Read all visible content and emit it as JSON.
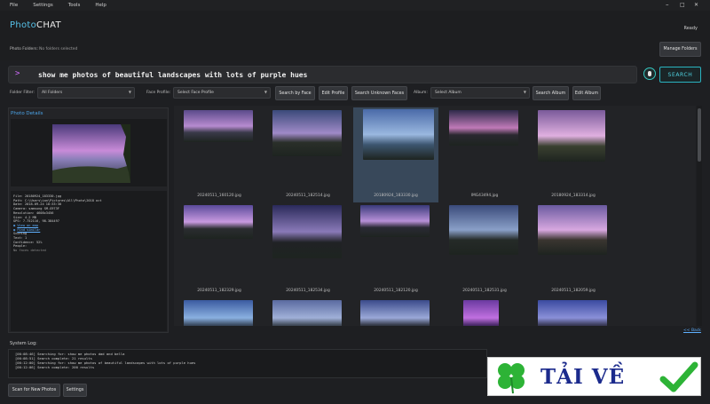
{
  "menu": [
    "File",
    "Settings",
    "Tools",
    "Help"
  ],
  "window_controls": {
    "minimize": "–",
    "maximize": "□",
    "close": "✕"
  },
  "app": {
    "logo_part1": "Photo",
    "logo_part2": "CHAT",
    "status": "Ready"
  },
  "folders": {
    "label": "Photo Folders:",
    "value": "No folders selected",
    "manage_button": "Manage Folders"
  },
  "search": {
    "prompt": ">",
    "query": "show me photos of beautiful landscapes with lots of purple hues",
    "button": "SEARCH"
  },
  "filters": {
    "folder_label": "Folder Filter:",
    "folder_value": "All Folders",
    "face_label": "Face Profile:",
    "face_value": "Select Face Profile",
    "search_by_face": "Search by Face",
    "edit_profile": "Edit Profile",
    "search_unknown": "Search Unknown Faces",
    "album_label": "Album:",
    "album_value": "Select Album",
    "search_album": "Search Album",
    "edit_album": "Edit Album"
  },
  "details_panel": {
    "title": "Photo Details",
    "lines": [
      "File: 20180924_183330.jpg",
      "Path: C:\\Users\\ian\\Pictures\\All\\Photo\\2018 oct",
      "Date: 2018-09-24 18:33:30",
      "Camera: samsung SM-G973F",
      "Resolution: 4608x3456",
      "Size: 4.2 MB",
      "GPS: 7.752116, 98.384497"
    ],
    "link_map": "View on map",
    "link_similar": "Find similar",
    "lines2": [
      "Scoring",
      "Text: 1",
      "Confidence: 52%",
      "People:",
      "No faces detected"
    ]
  },
  "photos": [
    {
      "name": "20240511_160120.jpg"
    },
    {
      "name": "20240511_182514.jpg"
    },
    {
      "name": "20180924_183330.jpg"
    },
    {
      "name": "IMG43494.jpg"
    },
    {
      "name": "20180924_183314.jpg"
    },
    {
      "name": "20240511_182329.jpg"
    },
    {
      "name": "20240511_182534.jpg"
    },
    {
      "name": "20240511_182120.jpg"
    },
    {
      "name": "20240511_182531.jpg"
    },
    {
      "name": "20240511_182059.jpg"
    },
    {
      "name": ""
    },
    {
      "name": ""
    },
    {
      "name": ""
    },
    {
      "name": ""
    },
    {
      "name": ""
    }
  ],
  "back_link": "<< Back",
  "system_log": {
    "label": "System Log:",
    "lines": [
      "[00:08:46] Searching for: show me photos dad and bella",
      "[00:08:51] Search complete: 21 results",
      "[00:12:00] Searching for: show me photos of beautiful landscapes with lots of purple hues",
      "[00:12:06] Search complete: 200 results"
    ]
  },
  "bottom": {
    "scan_button": "Scan for New Photos",
    "settings_button": "Settings"
  },
  "watermark": {
    "text": "TẢI VỀ"
  },
  "colors": {
    "accent": "#4ba4e8",
    "search_accent": "#2ab3c0",
    "prompt": "#d36cff",
    "selected_cell": "#38485a"
  }
}
